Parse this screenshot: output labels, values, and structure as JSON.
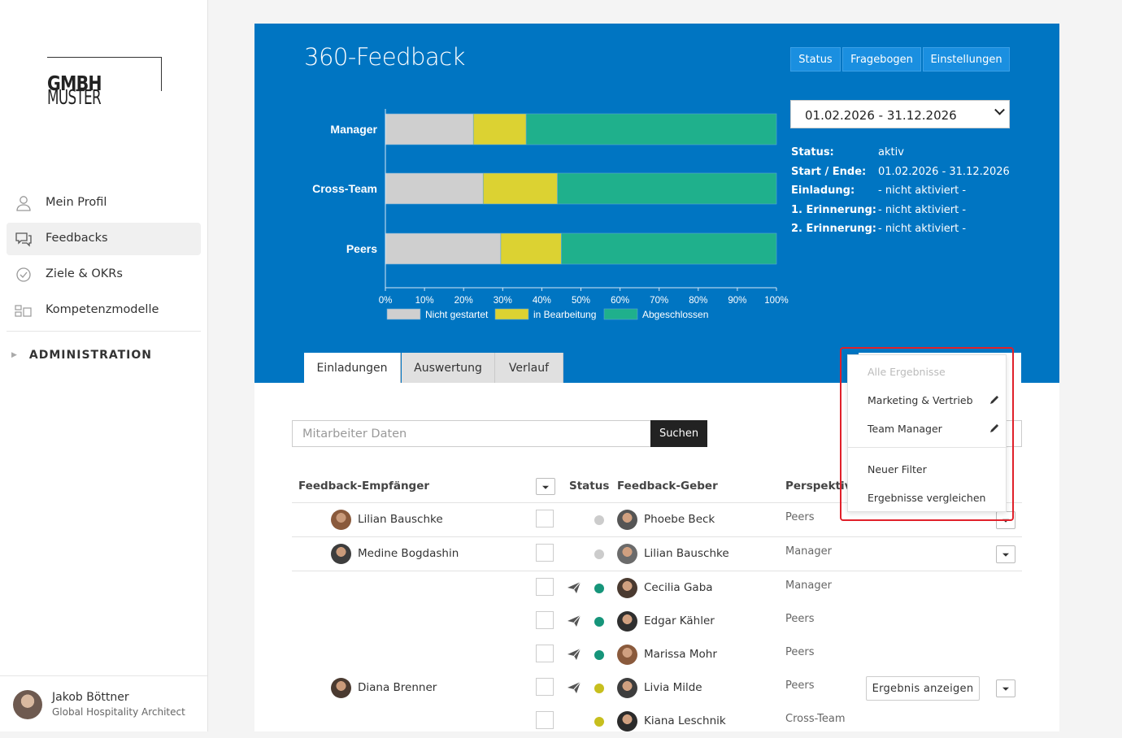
{
  "brand": {
    "logo_light": "MUSTER",
    "logo_bold": "GMBH"
  },
  "sidebar": {
    "items": [
      {
        "label": "Mein Profil",
        "icon": "user-icon"
      },
      {
        "label": "Feedbacks",
        "icon": "chat-bubbles-icon",
        "active": true
      },
      {
        "label": "Ziele & OKRs",
        "icon": "check-circle-icon"
      },
      {
        "label": "Kompetenzmodelle",
        "icon": "modules-icon"
      }
    ],
    "admin_label": "ADMINISTRATION",
    "user": {
      "name": "Jakob Böttner",
      "role": "Global Hospitality Architect"
    }
  },
  "header": {
    "title": "360-Feedback",
    "buttons": [
      "Status",
      "Fragebogen",
      "Einstellungen"
    ],
    "period_selected": "01.02.2026 - 31.12.2026",
    "info": [
      {
        "key": "Status:",
        "value": "aktiv"
      },
      {
        "key": "Start / Ende:",
        "value": "01.02.2026 - 31.12.2026"
      },
      {
        "key": "Einladung:",
        "value": "- nicht aktiviert -"
      },
      {
        "key": "1. Erinnerung:",
        "value": "- nicht aktiviert -"
      },
      {
        "key": "2. Erinnerung:",
        "value": "- nicht aktiviert -"
      }
    ]
  },
  "chart_data": {
    "type": "bar",
    "orientation": "horizontal",
    "stacked": true,
    "categories": [
      "Manager",
      "Cross-Team",
      "Peers"
    ],
    "series": [
      {
        "name": "Nicht gestartet",
        "color": "#cfcfcf",
        "values": [
          22.5,
          25,
          29.5
        ]
      },
      {
        "name": "in Bearbeitung",
        "color": "#dcd232",
        "values": [
          13.5,
          19,
          15.5
        ]
      },
      {
        "name": "Abgeschlossen",
        "color": "#1fb08c",
        "values": [
          64,
          56,
          55
        ]
      }
    ],
    "xlim": [
      0,
      100
    ],
    "ticks": [
      "0%",
      "10%",
      "20%",
      "30%",
      "40%",
      "50%",
      "60%",
      "70%",
      "80%",
      "90%",
      "100%"
    ],
    "legend": "bottom"
  },
  "tabs": [
    "Einladungen",
    "Auswertung",
    "Verlauf"
  ],
  "search": {
    "placeholder": "Mitarbeiter Daten",
    "button": "Suchen"
  },
  "table": {
    "headers": {
      "recipient": "Feedback-Empfänger",
      "status": "Status",
      "giver": "Feedback-Geber",
      "perspective": "Perspektive"
    },
    "rows": [
      {
        "recipient": "Lilian Bauschke",
        "giver": "Phoebe Beck",
        "perspective": "Peers",
        "status_color": "#cccccc",
        "sent": false
      },
      {
        "recipient": "Medine Bogdashin",
        "giver": "Lilian Bauschke",
        "perspective": "Manager",
        "status_color": "#cccccc",
        "sent": false
      },
      {
        "recipient": "",
        "giver": "Cecilia Gaba",
        "perspective": "Manager",
        "status_color": "#16957a",
        "sent": true
      },
      {
        "recipient": "",
        "giver": "Edgar Kähler",
        "perspective": "Peers",
        "status_color": "#16957a",
        "sent": true
      },
      {
        "recipient": "",
        "giver": "Marissa Mohr",
        "perspective": "Peers",
        "status_color": "#16957a",
        "sent": true
      },
      {
        "recipient": "Diana Brenner",
        "giver": "Livia Milde",
        "perspective": "Peers",
        "status_color": "#c7bf1e",
        "sent": true
      },
      {
        "recipient": "",
        "giver": "Kiana Leschnik",
        "perspective": "Cross-Team",
        "status_color": "#c7bf1e",
        "sent": false
      }
    ],
    "result_button": "Ergebnis anzeigen"
  },
  "dropdown": {
    "items": [
      "Alle Ergebnisse",
      "Marketing & Vertrieb",
      "Team Manager",
      "Neuer Filter",
      "Ergebnisse vergleichen"
    ]
  },
  "colors": {
    "banner": "#0075c2",
    "highlight": "#e0202a"
  }
}
